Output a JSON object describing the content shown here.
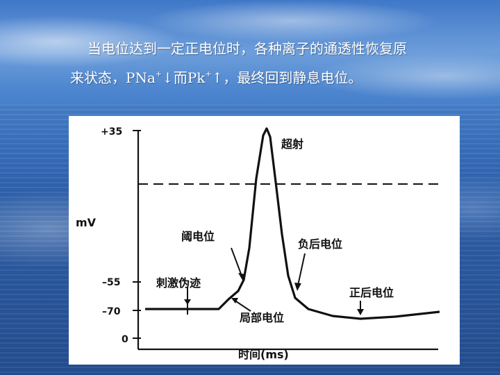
{
  "slide": {
    "line1": "当电位达到一定正电位时，各种离子的通透性恢复原",
    "line2_a": "来状态，PNa",
    "line2_sup1": "+",
    "line2_b": "↓而Pk",
    "line2_sup2": "+",
    "line2_c": "↑，最终回到静息电位。"
  },
  "diagram": {
    "y_axis_label": "mV",
    "x_axis_label": "时间(ms)",
    "ticks": [
      "+35",
      "–55",
      "–70",
      "0"
    ],
    "labels": {
      "overshoot": "超射",
      "threshold": "阈电位",
      "negative_after": "负后电位",
      "stimulus_artifact": "刺激伪迹",
      "positive_after": "正后电位",
      "local_potential": "局部电位"
    },
    "colors": {
      "curve": "#111111",
      "text": "#ffffff"
    }
  }
}
